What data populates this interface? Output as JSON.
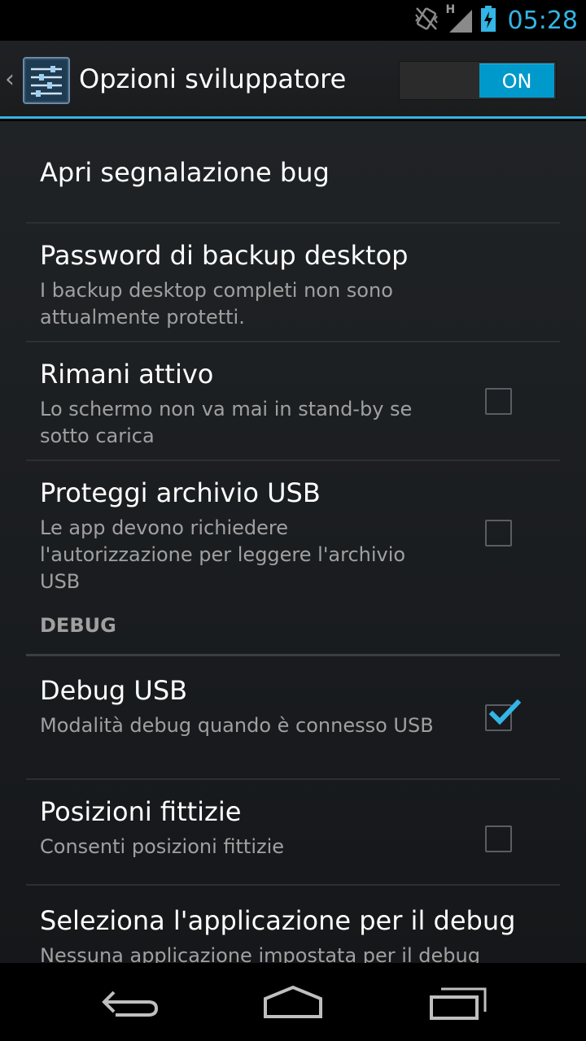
{
  "status_bar": {
    "time": "05:28",
    "network_type": "H",
    "icons": [
      "vibrate-icon",
      "signal-icon",
      "battery-charging-icon"
    ]
  },
  "action_bar": {
    "title": "Opzioni sviluppatore",
    "switch_label": "ON",
    "switch_on": true
  },
  "prefs": [
    {
      "title": "Apri segnalazione bug"
    },
    {
      "title": "Password di backup desktop",
      "summary": "I backup desktop completi non sono attualmente protetti."
    },
    {
      "title": "Rimani attivo",
      "summary": "Lo schermo non va mai in stand-by se sotto carica",
      "checked": false
    },
    {
      "title": "Proteggi archivio USB",
      "summary": "Le app devono richiedere l'autorizzazione per leggere l'archivio USB",
      "checked": false
    }
  ],
  "section_debug": "DEBUG",
  "debug_prefs": [
    {
      "title": "Debug USB",
      "summary": "Modalità debug quando è connesso USB",
      "checked": true
    },
    {
      "title": "Posizioni fittizie",
      "summary": "Consenti posizioni fittizie",
      "checked": false
    },
    {
      "title": "Seleziona l'applicazione per il debug",
      "summary": "Nessuna applicazione impostata per il debug"
    }
  ],
  "colors": {
    "accent": "#33b5e5",
    "switch_on": "#0099cc"
  }
}
